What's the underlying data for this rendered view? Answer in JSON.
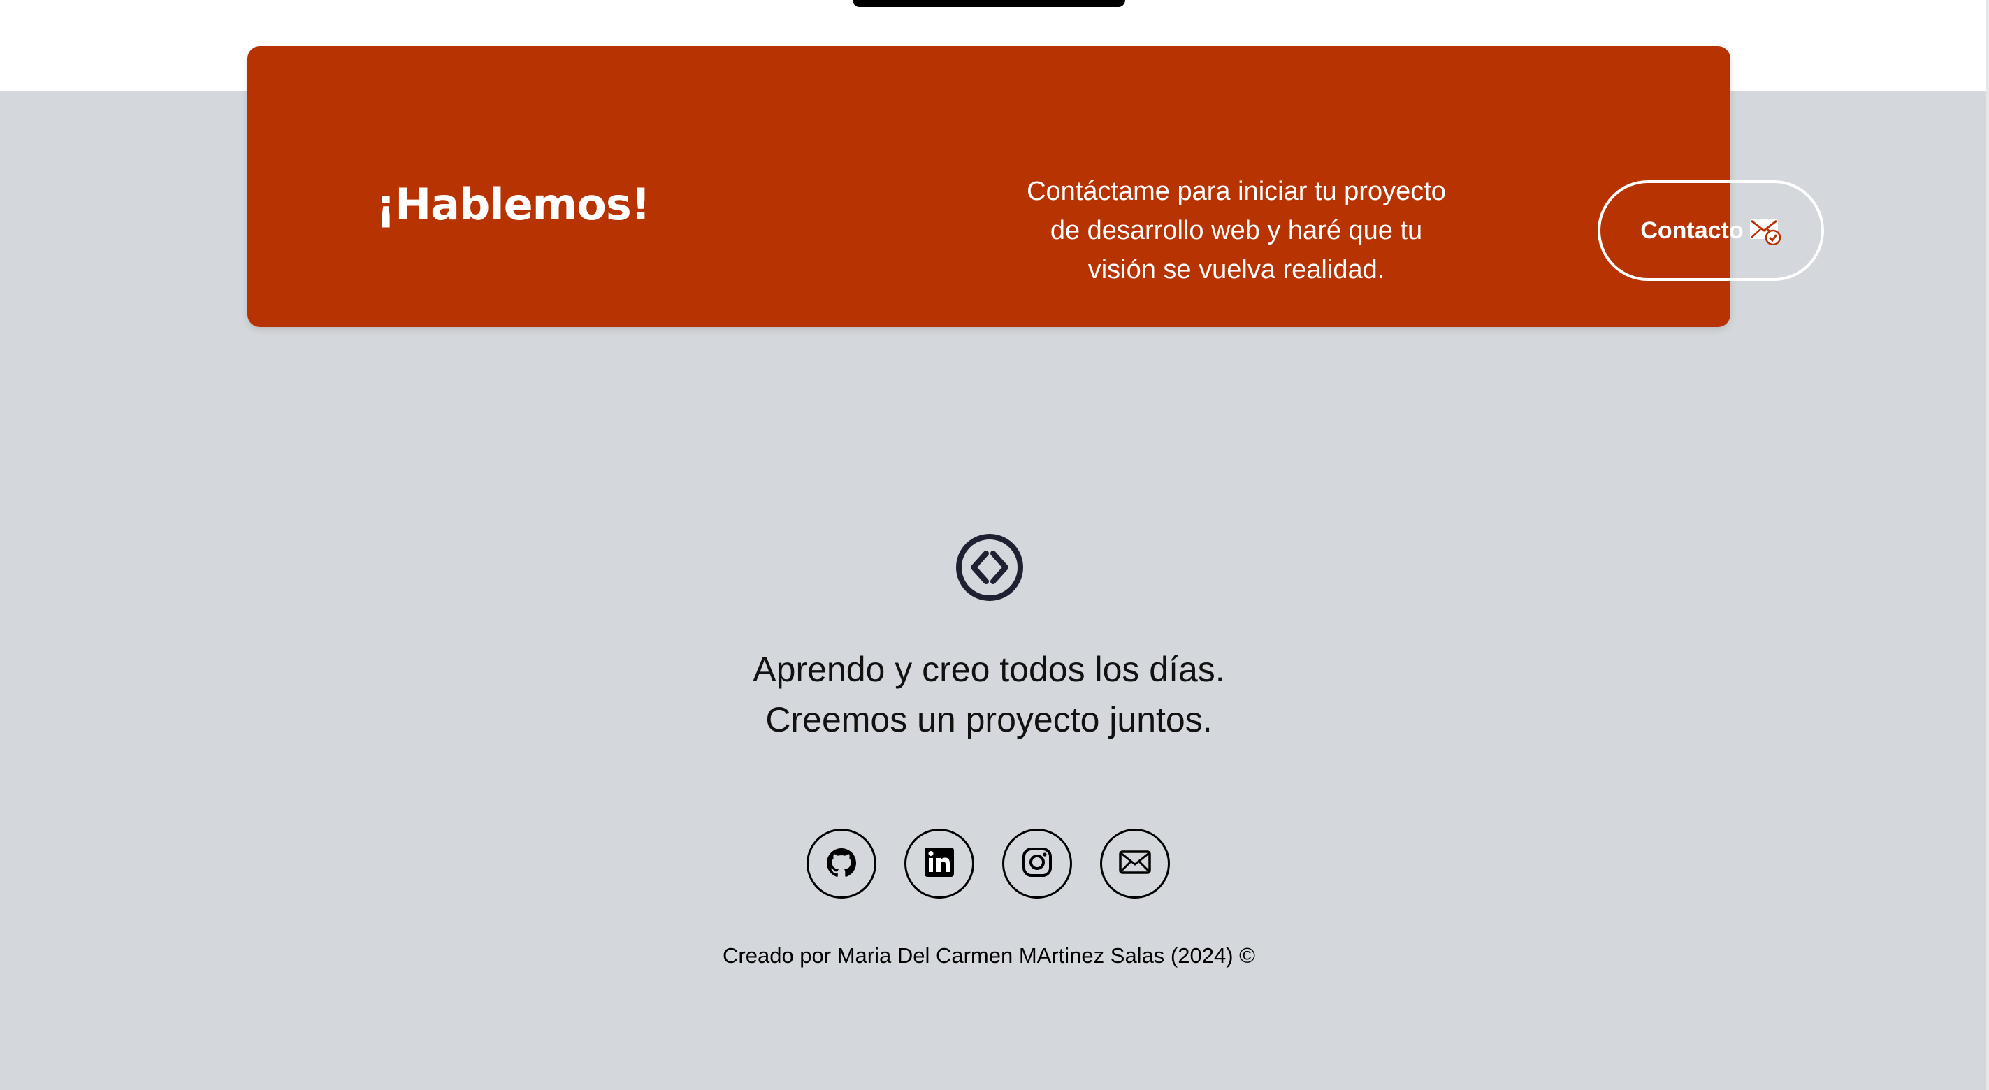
{
  "colors": {
    "accent": "#b83302",
    "page_background": "#d4d7db",
    "text": "#111111"
  },
  "cta": {
    "title": "¡Hablemos!",
    "text_lines": [
      "Contáctame para iniciar tu proyecto",
      "de desarrollo web y haré que tu",
      "visión se vuelva realidad."
    ],
    "button_label": "Contacto",
    "button_icon": "mail-check-icon"
  },
  "footer": {
    "logo_icon": "code-brackets-icon",
    "tagline_lines": [
      "Aprendo y creo todos los días.",
      "Creemos un proyecto juntos."
    ],
    "social": [
      {
        "icon": "github-icon"
      },
      {
        "icon": "linkedin-icon"
      },
      {
        "icon": "instagram-icon"
      },
      {
        "icon": "email-icon"
      }
    ],
    "credit": "Creado por Maria Del Carmen MArtinez Salas (2024) ©"
  }
}
